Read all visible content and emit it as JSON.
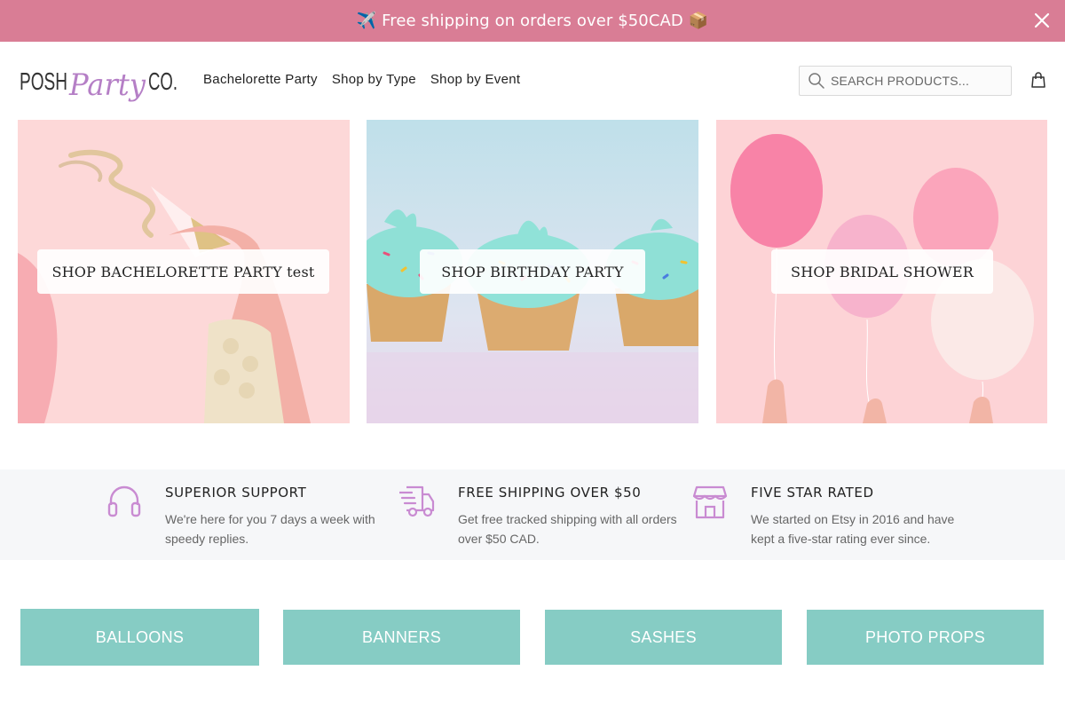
{
  "announcement": {
    "text": "✈️ Free shipping on orders over $50CAD 📦",
    "close_icon": "close-icon"
  },
  "header": {
    "logo": {
      "word1": "POSH",
      "word2": "Party",
      "word3": "CO."
    },
    "nav": [
      "Bachelorette Party",
      "Shop by Type",
      "Shop by Event"
    ],
    "search": {
      "placeholder": "SEARCH PRODUCTS..."
    },
    "cart_icon": "shopping-bag-icon"
  },
  "tiles": [
    {
      "label": "SHOP BACHELORETTE PARTY test"
    },
    {
      "label": "SHOP BIRTHDAY PARTY"
    },
    {
      "label": "SHOP BRIDAL SHOWER"
    }
  ],
  "features": [
    {
      "icon": "headphones-icon",
      "title": "SUPERIOR SUPPORT",
      "text": "We're here for you 7 days a week with speedy replies."
    },
    {
      "icon": "delivery-truck-icon",
      "title": "FREE SHIPPING OVER $50",
      "text": "Get free tracked shipping with all orders over $50 CAD."
    },
    {
      "icon": "storefront-icon",
      "title": "FIVE STAR RATED",
      "text": "We started on Etsy in 2016 and have kept a five-star rating ever since."
    }
  ],
  "categories": [
    "BALLOONS",
    "BANNERS",
    "SASHES",
    "PHOTO PROPS"
  ],
  "colors": {
    "announcement_bg": "#d97d95",
    "logo_accent": "#b57fc6",
    "feature_icon": "#c98bd2",
    "category_bg": "#86ccc4"
  }
}
